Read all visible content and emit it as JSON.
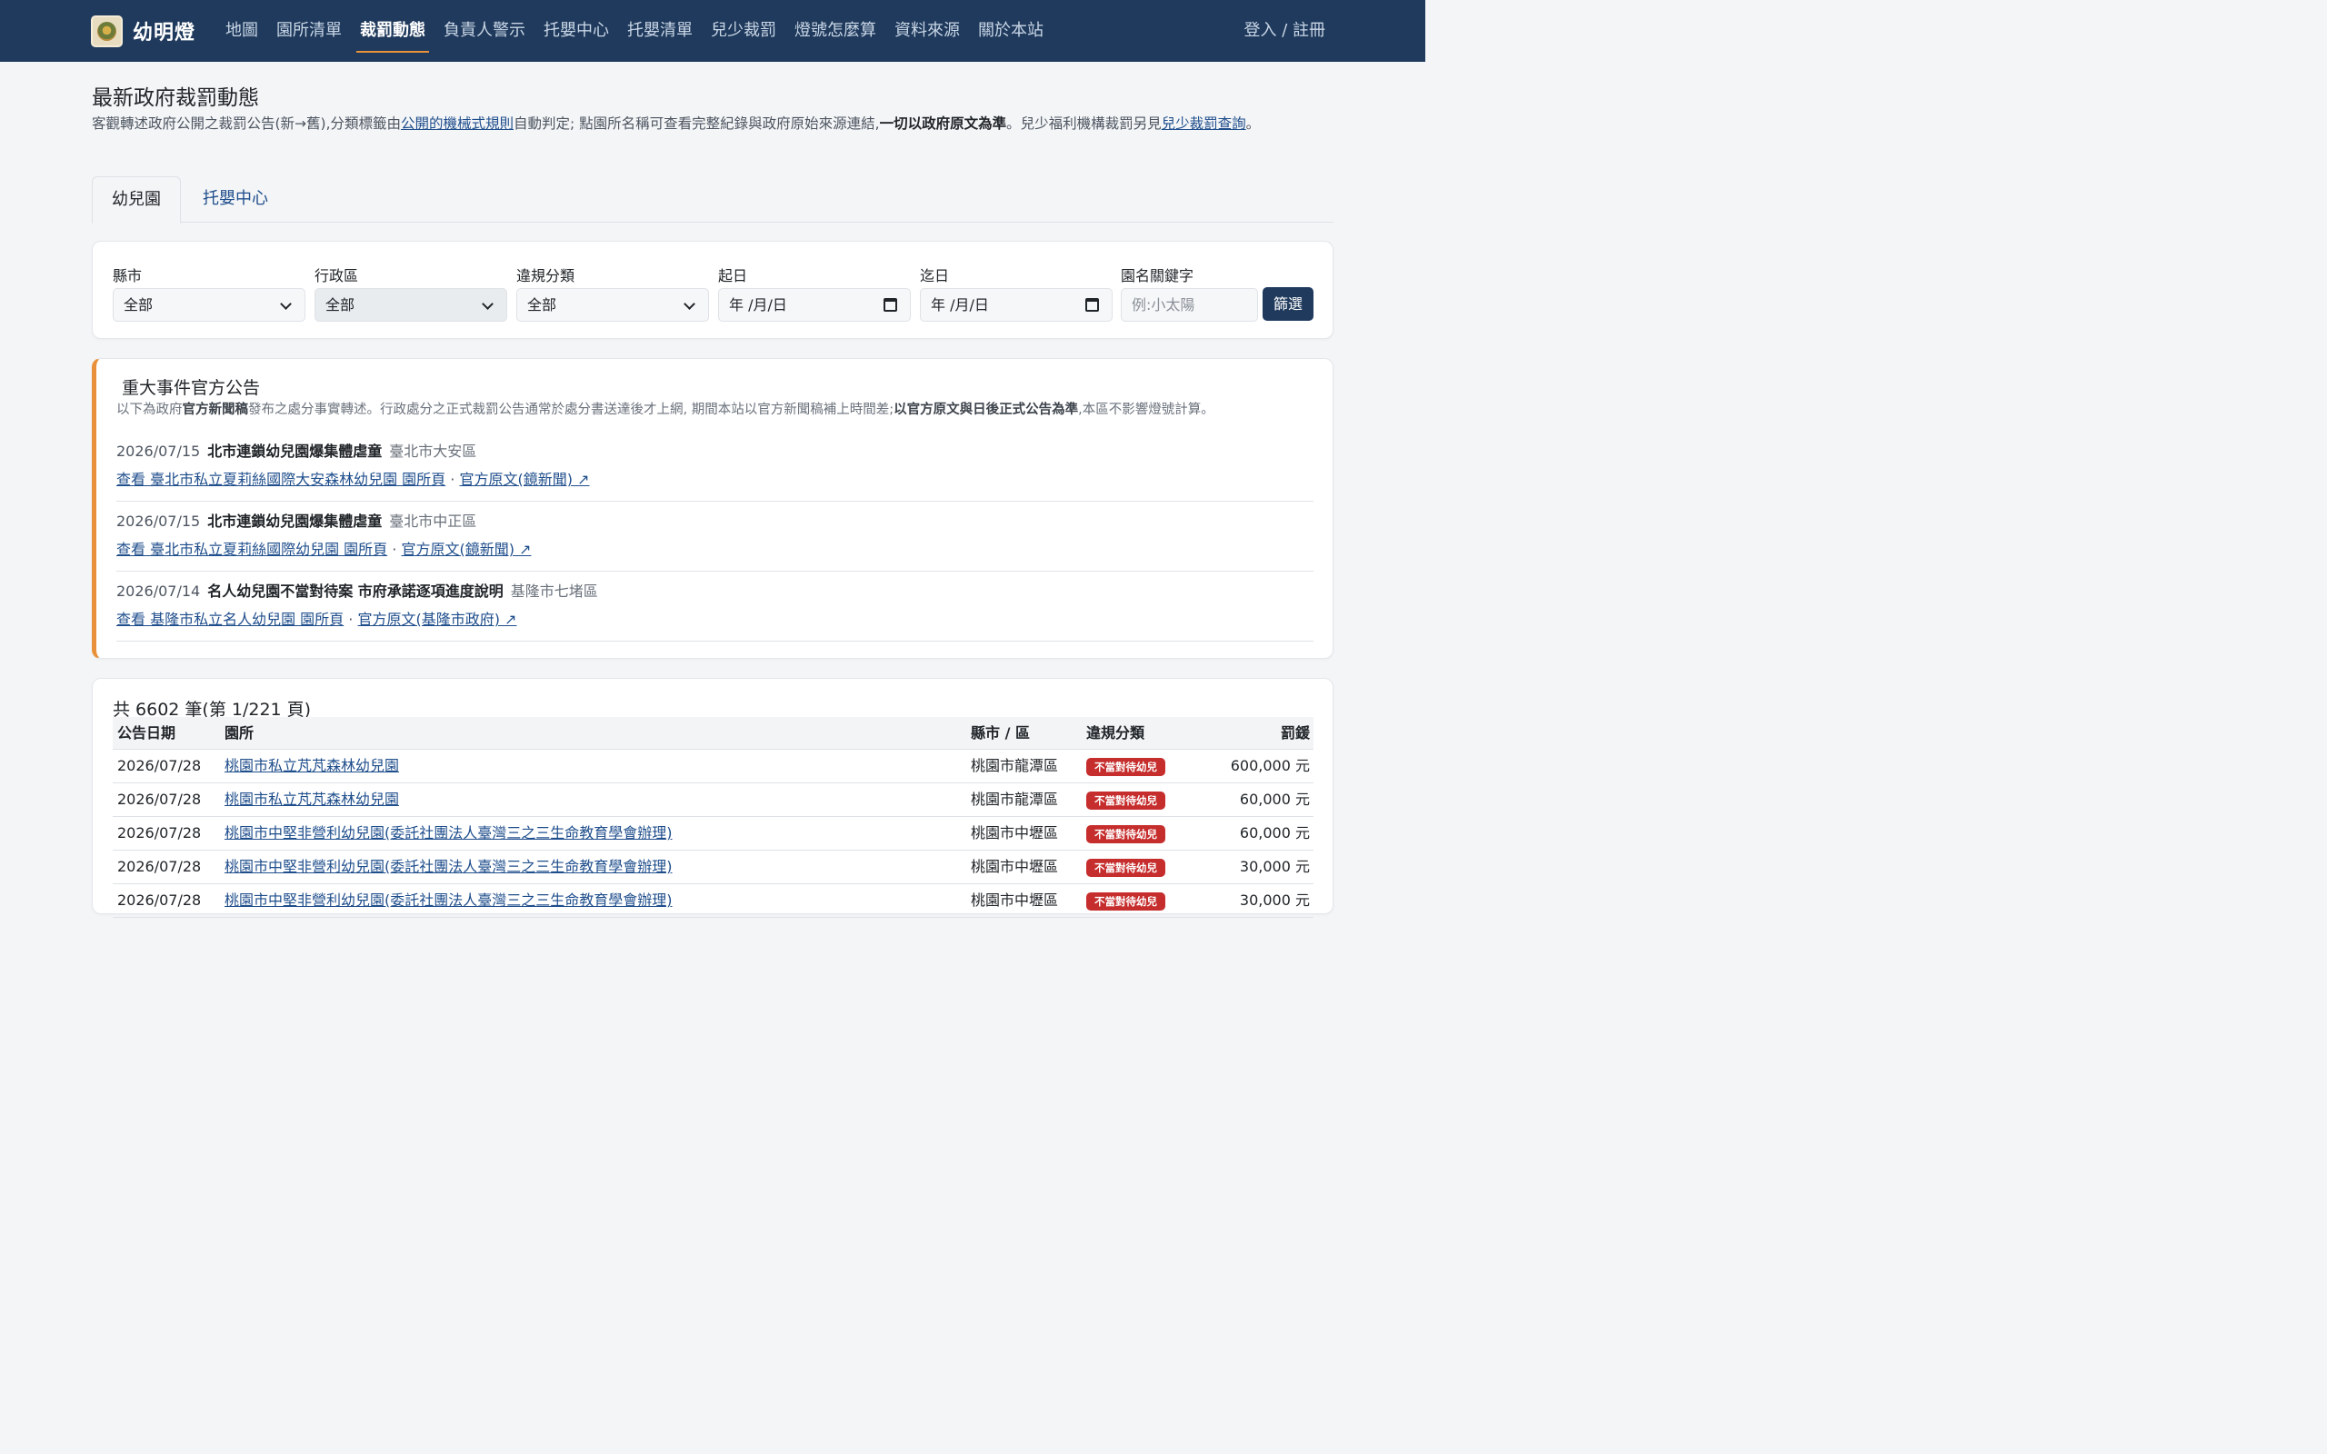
{
  "brand": {
    "name": "幼明燈"
  },
  "nav": {
    "links": [
      "地圖",
      "園所清單",
      "裁罰動態",
      "負責人警示",
      "托嬰中心",
      "托嬰清單",
      "兒少裁罰",
      "燈號怎麼算",
      "資料來源",
      "關於本站"
    ],
    "active_index": 2,
    "auth": "登入 / 註冊"
  },
  "header": {
    "title": "最新政府裁罰動態",
    "intro_1": "客觀轉述政府公開之裁罰公告(新→舊),分類標籤由",
    "intro_link_1": "公開的機械式規則",
    "intro_2": "自動判定; 點園所名稱可查看完整紀錄與政府原始來源連結,",
    "intro_bold": "一切以政府原文為準",
    "intro_3": "。兒少福利機構裁罰另見",
    "intro_link_2": "兒少裁罰查詢",
    "intro_4": "。"
  },
  "tabs": [
    "幼兒園",
    "托嬰中心"
  ],
  "filters": {
    "county_label": "縣市",
    "county_value": "全部",
    "district_label": "行政區",
    "district_value": "全部",
    "category_label": "違規分類",
    "category_value": "全部",
    "start_label": "起日",
    "start_value": "年 /月/日",
    "end_label": "迄日",
    "end_value": "年 /月/日",
    "keyword_label": "園名關鍵字",
    "keyword_placeholder": "例:小太陽",
    "submit": "篩選"
  },
  "announcements": {
    "title": "重大事件官方公告",
    "desc_1": "以下為政府",
    "desc_bold_1": "官方新聞稿",
    "desc_2": "發布之處分事實轉述。行政處分之正式裁罰公告通常於處分書送達後才上網, 期間本站以官方新聞稿補上時間差;",
    "desc_bold_2": "以官方原文與日後正式公告為準",
    "desc_3": ",本區不影響燈號計算。",
    "items": [
      {
        "date": "2026/07/15",
        "headline": "北市連鎖幼兒園爆集體虐童",
        "area": "臺北市大安區",
        "link_school": "查看 臺北市私立夏莉絲國際大安森林幼兒園 園所頁",
        "sep": "·",
        "link_source": "官方原文(鏡新聞) ↗"
      },
      {
        "date": "2026/07/15",
        "headline": "北市連鎖幼兒園爆集體虐童",
        "area": "臺北市中正區",
        "link_school": "查看 臺北市私立夏莉絲國際幼兒園 園所頁",
        "sep": "·",
        "link_source": "官方原文(鏡新聞) ↗"
      },
      {
        "date": "2026/07/14",
        "headline": "名人幼兒園不當對待案 市府承諾逐項進度說明",
        "area": "基隆市七堵區",
        "link_school": "查看 基隆市私立名人幼兒園 園所頁",
        "sep": "·",
        "link_source": "官方原文(基隆市政府) ↗"
      }
    ]
  },
  "table": {
    "count_text": "共 6602 筆(第 1/221 頁)",
    "columns": [
      "公告日期",
      "園所",
      "縣市 / 區",
      "違規分類",
      "罰鍰"
    ],
    "rows": [
      {
        "date": "2026/07/28",
        "name": "桃園市私立芃芃森林幼兒園",
        "area": "桃園市龍潭區",
        "category": "不當對待幼兒",
        "fine": "600,000 元"
      },
      {
        "date": "2026/07/28",
        "name": "桃園市私立芃芃森林幼兒園",
        "area": "桃園市龍潭區",
        "category": "不當對待幼兒",
        "fine": "60,000 元"
      },
      {
        "date": "2026/07/28",
        "name": "桃園市中堅非營利幼兒園(委託社團法人臺灣三之三生命教育學會辦理)",
        "area": "桃園市中壢區",
        "category": "不當對待幼兒",
        "fine": "60,000 元"
      },
      {
        "date": "2026/07/28",
        "name": "桃園市中堅非營利幼兒園(委託社團法人臺灣三之三生命教育學會辦理)",
        "area": "桃園市中壢區",
        "category": "不當對待幼兒",
        "fine": "30,000 元"
      },
      {
        "date": "2026/07/28",
        "name": "桃園市中堅非營利幼兒園(委託社團法人臺灣三之三生命教育學會辦理)",
        "area": "桃園市中壢區",
        "category": "不當對待幼兒",
        "fine": "30,000 元"
      }
    ]
  },
  "colors": {
    "navbar": "#1f3a5c",
    "accent": "#e8913a",
    "link": "#1f4e8c",
    "badge": "#c62d2d"
  }
}
